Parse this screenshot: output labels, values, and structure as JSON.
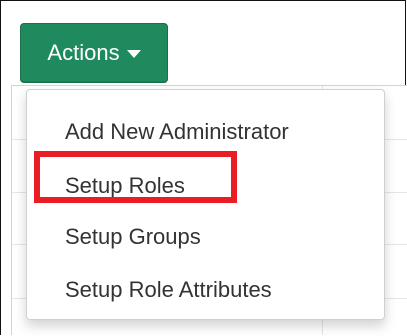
{
  "toolbar": {
    "actions_label": "Actions",
    "accent_color": "#1f8a5d"
  },
  "menu": {
    "items": [
      {
        "label": "Add New Administrator"
      },
      {
        "label": "Setup Roles"
      },
      {
        "label": "Setup Groups"
      },
      {
        "label": "Setup Role Attributes"
      }
    ],
    "highlighted_item": "Setup Roles",
    "highlight_color": "#ea1d25"
  },
  "icons": {
    "actions_caret": "chevron-down-icon"
  }
}
